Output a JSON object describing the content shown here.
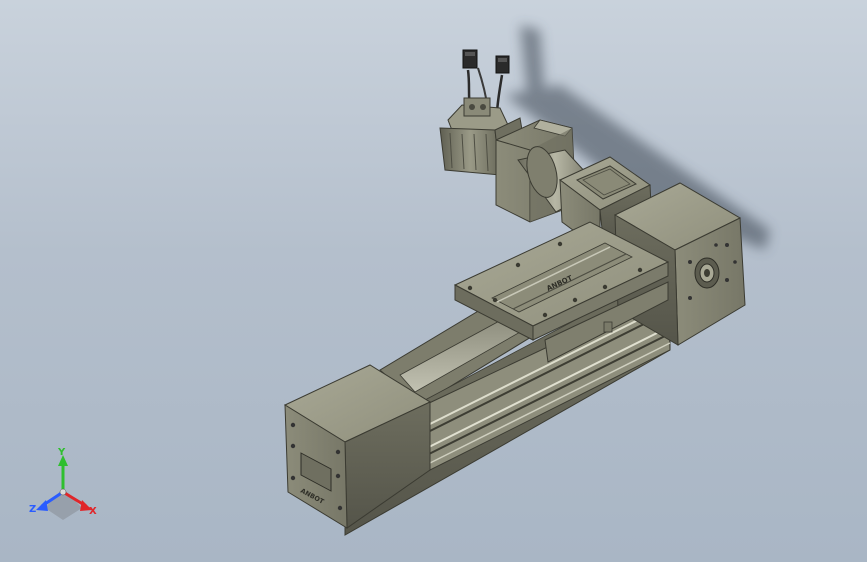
{
  "viewport": {
    "background_top": "#c9d2dc",
    "background_bottom": "#a9b6c5",
    "model": {
      "name": "linear-actuator-with-servo-motor",
      "body_color": "#8a8a78",
      "body_dark": "#5e5e50",
      "body_light": "#b4b4a2",
      "logo_text": "ANBOT",
      "carriage_logo_text": "ANBOT"
    },
    "triad": {
      "x_label": "X",
      "y_label": "Y",
      "z_label": "Z",
      "x_color": "#e0262a",
      "y_color": "#2fbf2f",
      "z_color": "#2a5cff"
    }
  }
}
